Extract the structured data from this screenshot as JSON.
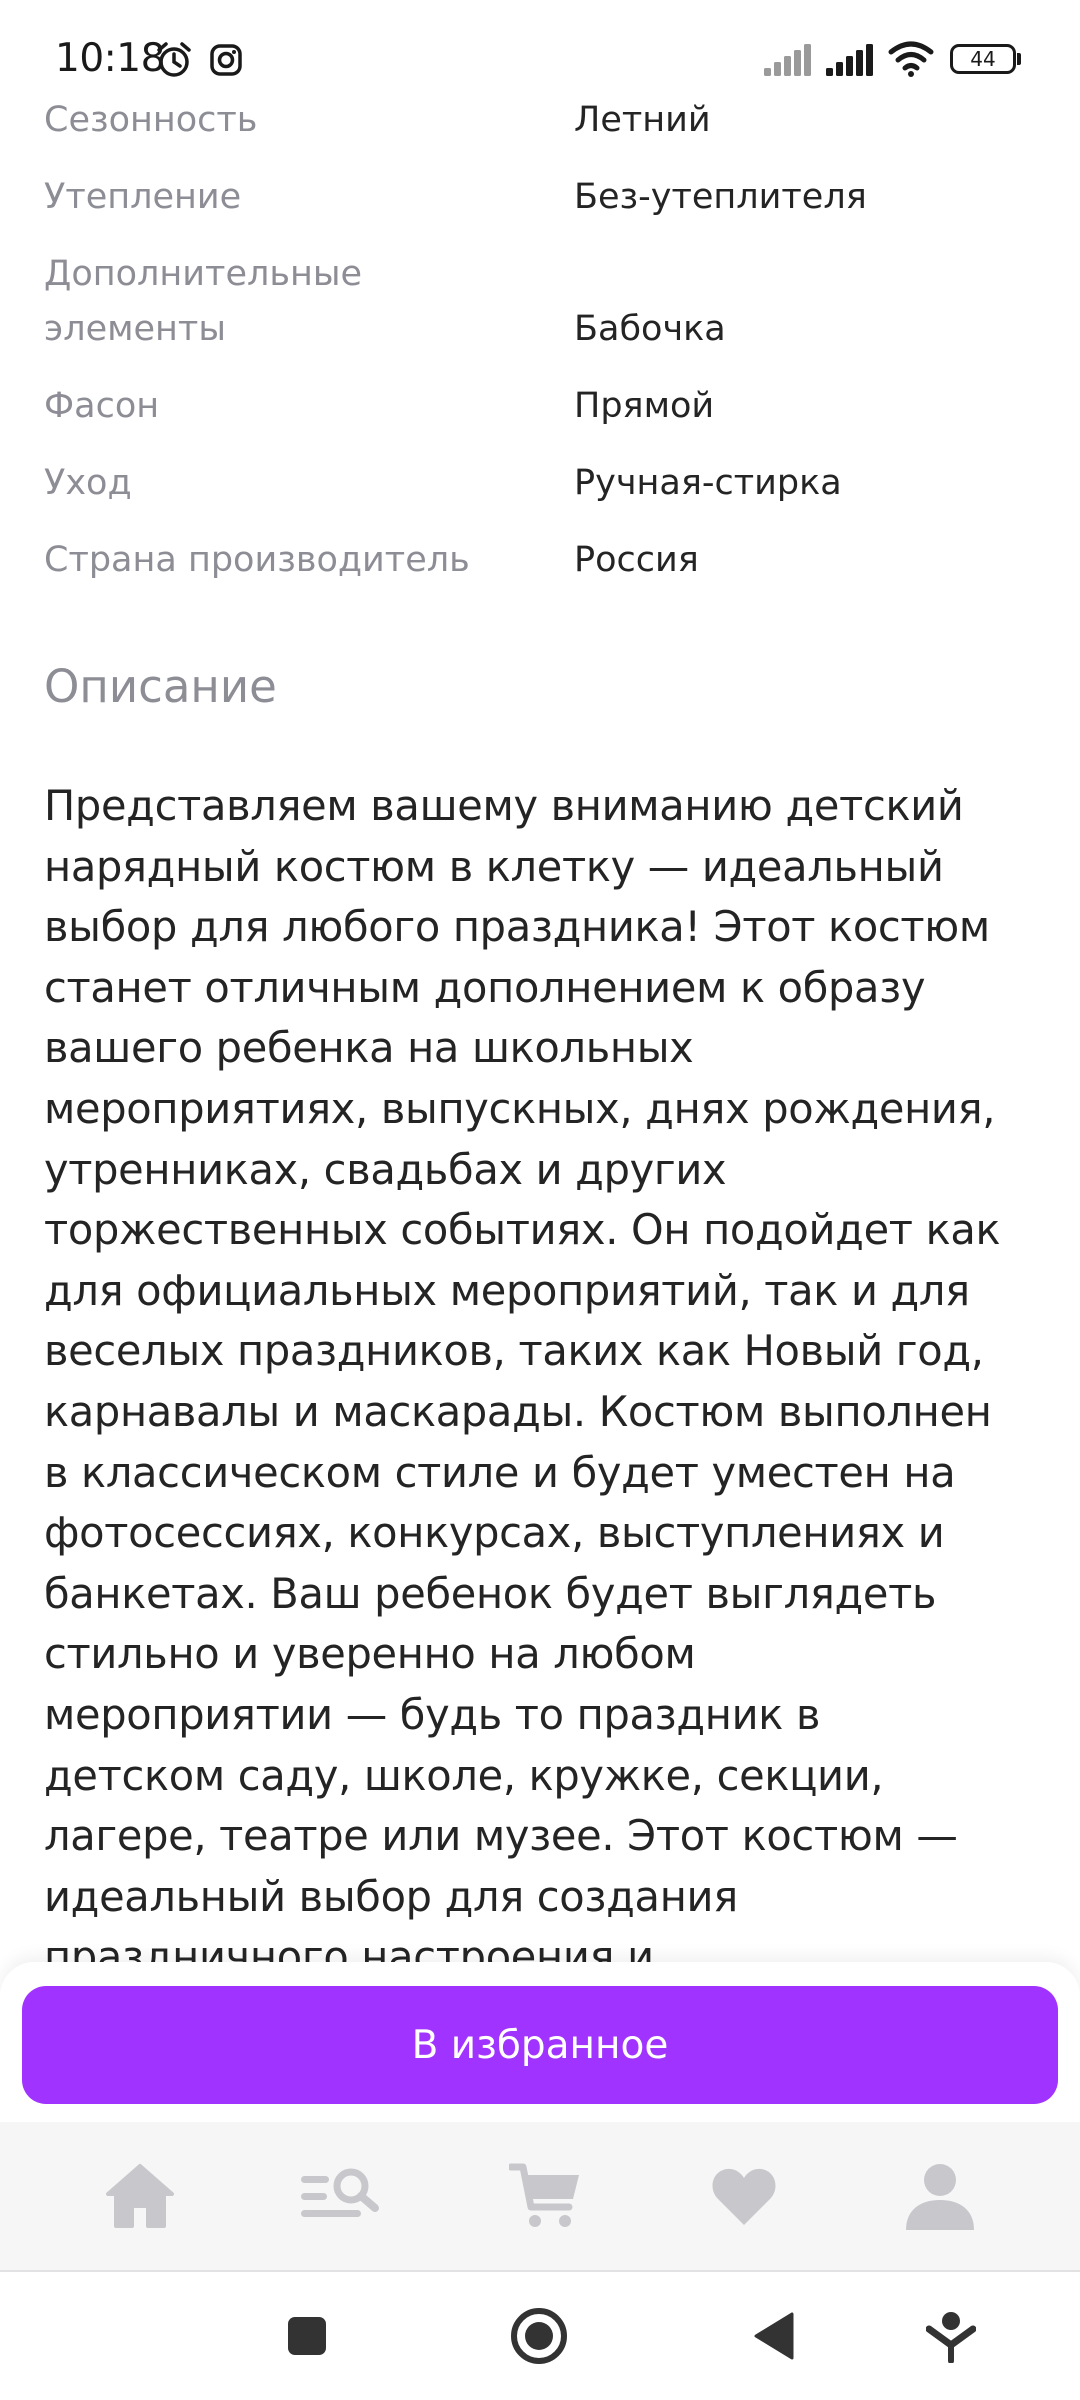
{
  "status_bar": {
    "time": "10:18",
    "battery": "44",
    "icons": [
      "alarm-icon",
      "instagram-icon",
      "signal-icon",
      "signal-icon",
      "wifi-icon",
      "battery-icon"
    ]
  },
  "specs": [
    {
      "label": "Сезонность",
      "value": "Летний"
    },
    {
      "label": "Утепление",
      "value": "Без-утеплителя"
    },
    {
      "label_line1": "Дополнительные",
      "label_line2": "элементы",
      "value": "Бабочка"
    },
    {
      "label": "Фасон",
      "value": "Прямой"
    },
    {
      "label": "Уход",
      "value": "Ручная-стирка"
    },
    {
      "label": "Страна производитель",
      "value": "Россия"
    }
  ],
  "description": {
    "title": "Описание",
    "lines": [
      "Представляем вашему вниманию детский",
      "нарядный костюм в клетку — идеальный",
      "выбор для любого праздника! Этот костюм",
      "станет отличным дополнением к образу",
      "вашего ребенка на школьных",
      "мероприятиях, выпускных, днях рождения,",
      "утренниках, свадьбах и других",
      "торжественных событиях. Он подойдет как",
      "для официальных мероприятий, так и для",
      "веселых праздников, таких как Новый год,",
      "карнавалы и маскарады. Костюм выполнен",
      "в классическом стиле и будет уместен на",
      "фотосессиях, конкурсах, выступлениях и",
      "банкетах. Ваш ребенок будет выглядеть",
      "стильно и уверенно на любом",
      "мероприятии — будь то праздник в",
      "детском саду, школе, кружке, секции,",
      "лагере, театре или музее. Этот костюм —",
      "идеальный выбор для создания",
      "праздничного настроения и"
    ]
  },
  "favorites_button": {
    "label": "В избранное",
    "color": "#a033ff"
  },
  "bottom_nav": {
    "items": [
      "home-icon",
      "catalog-search-icon",
      "cart-icon",
      "favorites-icon",
      "profile-icon"
    ],
    "icon_color": "#c8c8cc"
  },
  "system_nav": {
    "buttons": [
      "recents-icon",
      "home-circle-icon",
      "back-icon",
      "assistant-icon"
    ]
  }
}
